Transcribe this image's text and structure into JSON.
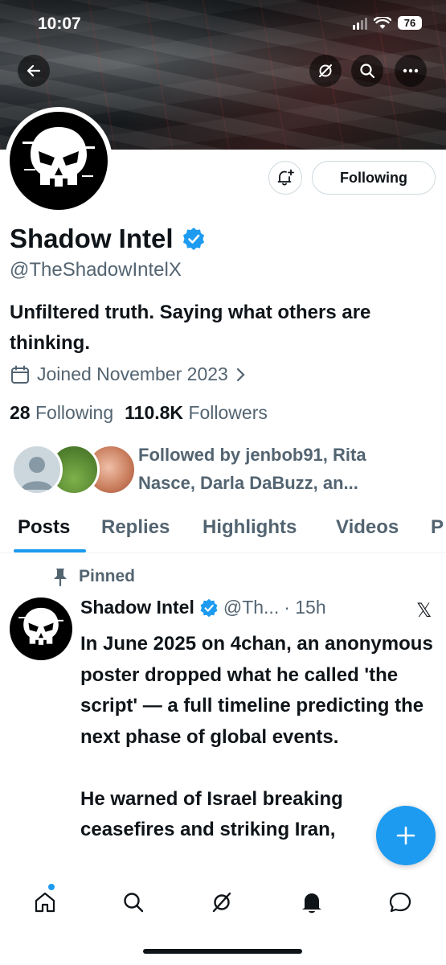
{
  "status_bar": {
    "time": "10:07",
    "battery": "76"
  },
  "profile": {
    "name": "Shadow Intel",
    "handle": "@TheShadowIntelX",
    "bio": "Unfiltered truth. Saying what others are thinking.",
    "joined": "Joined November 2023",
    "following_count": "28",
    "following_label": "Following",
    "followers_count": "110.8K",
    "followers_label": "Followers",
    "followed_by": "Followed by jenbob91, Rita Nasce, Darla DaBuzz, an...",
    "follow_button": "Following"
  },
  "tabs": [
    "Posts",
    "Replies",
    "Highlights",
    "Videos",
    "P"
  ],
  "post": {
    "pinned_label": "Pinned",
    "author": "Shadow Intel",
    "handle": "@Th...",
    "time": "· 15h",
    "text": "In June 2025 on 4chan, an anonymous poster dropped what he called 'the script' — a full timeline predicting the next phase of global events.\n\nHe warned of Israel breaking ceasefires and striking Iran,"
  },
  "icons": {
    "back": "back-arrow-icon",
    "grok": "grok-icon",
    "search": "search-icon",
    "more": "more-icon",
    "bell": "bell-plus-icon",
    "verified": "verified-badge-icon",
    "calendar": "calendar-icon",
    "pin": "pin-icon",
    "x": "x-logo-icon",
    "compose": "plus-icon"
  },
  "colors": {
    "accent": "#1d9bf0",
    "text": "#0f1419",
    "muted": "#536471"
  }
}
